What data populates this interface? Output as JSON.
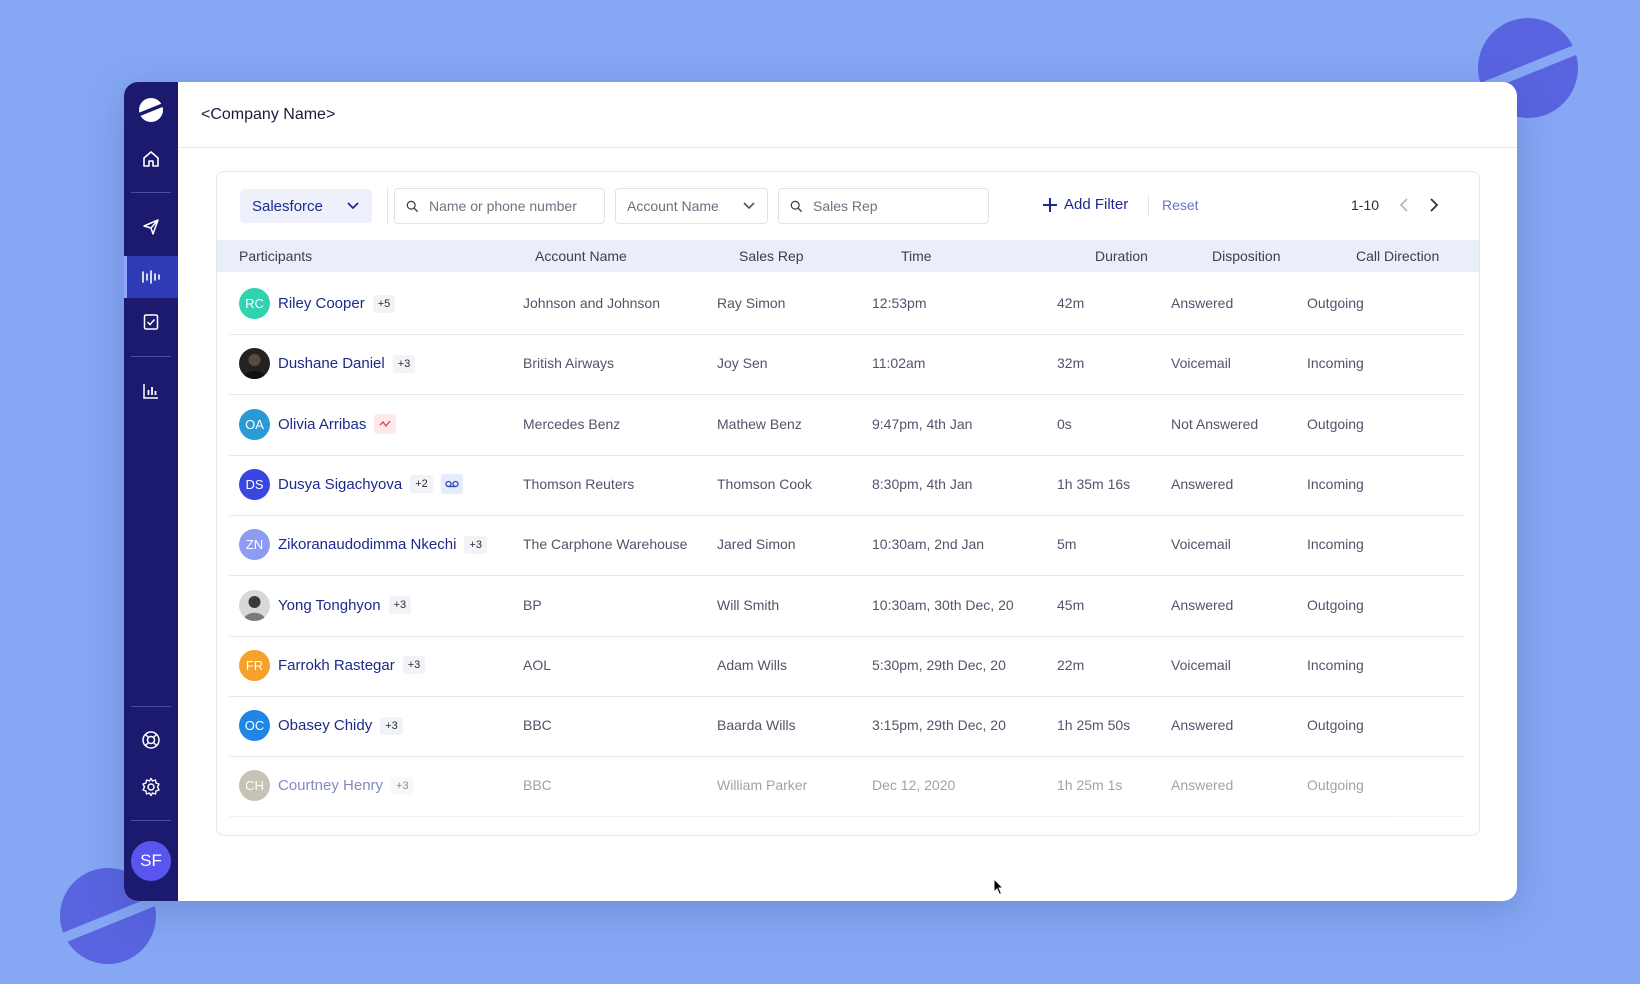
{
  "header": {
    "company": "<Company Name>"
  },
  "sidebar": {
    "items": [
      {
        "icon": "home-icon"
      },
      {
        "icon": "send-icon"
      },
      {
        "icon": "waveform-icon",
        "active": true
      },
      {
        "icon": "notes-icon"
      },
      {
        "icon": "bar-chart-icon"
      },
      {
        "icon": "help-lifebuoy-icon"
      },
      {
        "icon": "gear-icon"
      }
    ],
    "avatar": "SF"
  },
  "toolbar": {
    "source_select": "Salesforce",
    "search_placeholder": "Name or phone number",
    "account_dropdown": "Account Name",
    "sales_rep_placeholder": "Sales Rep",
    "add_filter": "Add Filter",
    "reset": "Reset",
    "pagination": "1-10"
  },
  "table": {
    "columns": [
      "Participants",
      "Account Name",
      "Sales Rep",
      "Time",
      "Duration",
      "Disposition",
      "Call Direction"
    ],
    "rows": [
      {
        "initials": "RC",
        "color": "#2fd3b0",
        "name": "Riley Cooper",
        "extra": "+5",
        "account": "Johnson and Johnson",
        "rep": "Ray Simon",
        "time": "12:53pm",
        "duration": "42m",
        "disposition": "Answered",
        "direction": "Outgoing"
      },
      {
        "initials": "",
        "color": "#222222",
        "photo": true,
        "name": "Dushane Daniel",
        "extra": "+3",
        "account": "British Airways",
        "rep": "Joy Sen",
        "time": "11:02am",
        "duration": "32m",
        "disposition": "Voicemail",
        "direction": "Incoming"
      },
      {
        "initials": "OA",
        "color": "#2a9ad6",
        "name": "Olivia Arribas",
        "extra": "",
        "icon": "trend-icon",
        "account": "Mercedes Benz",
        "rep": "Mathew Benz",
        "time": "9:47pm, 4th Jan",
        "duration": "0s",
        "disposition": "Not Answered",
        "direction": "Outgoing"
      },
      {
        "initials": "DS",
        "color": "#3a46e0",
        "name": "Dusya Sigachyova",
        "extra": "+2",
        "icon": "voicemail-icon",
        "account": "Thomson Reuters",
        "rep": "Thomson Cook",
        "time": "8:30pm, 4th Jan",
        "duration": "1h 35m 16s",
        "disposition": "Answered",
        "direction": "Incoming"
      },
      {
        "initials": "ZN",
        "color": "#8d9cf2",
        "name": "Zikoranaudodimma Nkechi",
        "extra": "+3",
        "account": "The Carphone Warehouse",
        "rep": "Jared Simon",
        "time": "10:30am, 2nd Jan",
        "duration": "5m",
        "disposition": "Voicemail",
        "direction": "Incoming"
      },
      {
        "initials": "",
        "color": "#d8d8d8",
        "photo": true,
        "name": "Yong Tonghyon",
        "extra": "+3",
        "account": "BP",
        "rep": "Will Smith",
        "time": "10:30am, 30th Dec, 20",
        "duration": "45m",
        "disposition": "Answered",
        "direction": "Outgoing"
      },
      {
        "initials": "FR",
        "color": "#f5a12a",
        "name": "Farrokh Rastegar",
        "extra": "+3",
        "account": "AOL",
        "rep": "Adam Wills",
        "time": "5:30pm, 29th Dec, 20",
        "duration": "22m",
        "disposition": "Voicemail",
        "direction": "Incoming"
      },
      {
        "initials": "OC",
        "color": "#1f86e6",
        "name": "Obasey Chidy",
        "extra": "+3",
        "account": "BBC",
        "rep": "Baarda Wills",
        "time": "3:15pm, 29th Dec, 20",
        "duration": "1h 25m 50s",
        "disposition": "Answered",
        "direction": "Outgoing"
      },
      {
        "initials": "CH",
        "color": "#9c8f7c",
        "name": "Courtney Henry",
        "extra": "+3",
        "account": "BBC",
        "rep": "William Parker",
        "time": "Dec 12, 2020",
        "duration": "1h 25m 1s",
        "disposition": "Answered",
        "direction": "Outgoing",
        "faded": true
      }
    ]
  }
}
